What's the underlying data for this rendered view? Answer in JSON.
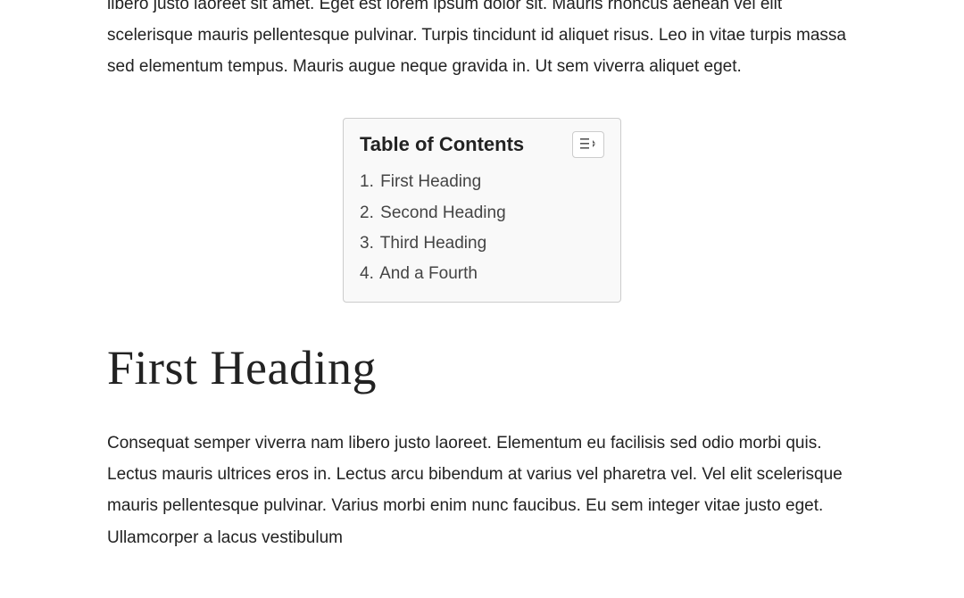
{
  "intro": {
    "text": "libero justo laoreet sit amet. Eget est lorem ipsum dolor sit. Mauris rhoncus aenean vel elit scelerisque mauris pellentesque pulvinar. Turpis tincidunt id aliquet risus. Leo in vitae turpis massa sed elementum tempus. Mauris augue neque gravida in. Ut sem viverra aliquet eget."
  },
  "toc": {
    "title": "Table of Contents",
    "items": [
      {
        "number": "1.",
        "label": "First Heading"
      },
      {
        "number": "2.",
        "label": "Second Heading"
      },
      {
        "number": "3.",
        "label": "Third Heading"
      },
      {
        "number": "4.",
        "label": "And a Fourth"
      }
    ]
  },
  "section": {
    "heading": "First Heading",
    "body": "Consequat semper viverra nam libero justo laoreet. Elementum eu facilisis sed odio morbi quis. Lectus mauris ultrices eros in. Lectus arcu bibendum at varius vel pharetra vel. Vel elit scelerisque mauris pellentesque pulvinar. Varius morbi enim nunc faucibus. Eu sem integer vitae justo eget. Ullamcorper a lacus vestibulum"
  }
}
